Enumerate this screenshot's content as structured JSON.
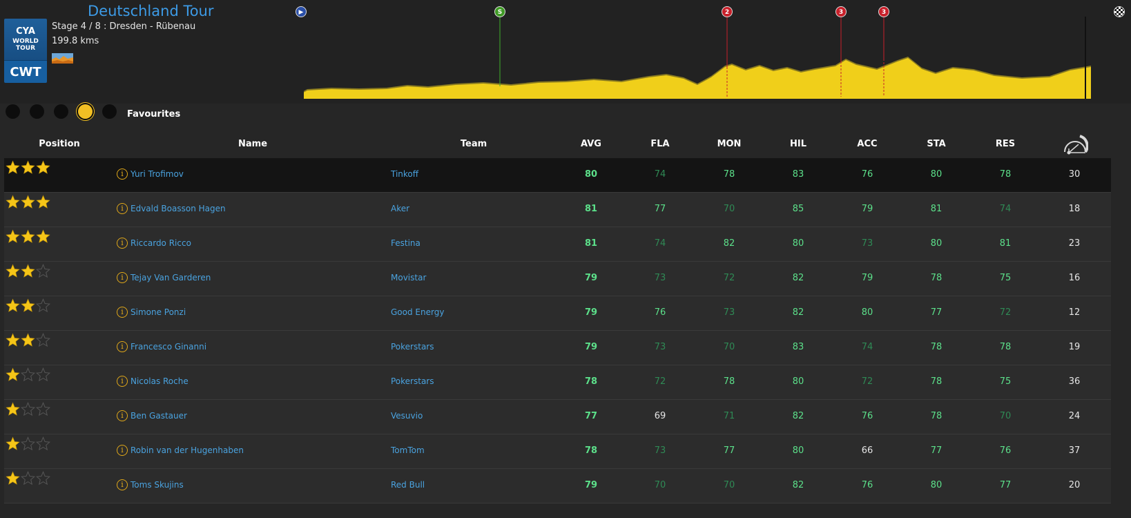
{
  "race": {
    "title": "Deutschland Tour",
    "stage": "Stage 4 / 8 : Dresden - Rübenau",
    "distance": "199.8 kms",
    "logo_top": "CYA",
    "logo_middle": "WORLD TOUR",
    "logo_bottom": "CWT",
    "terrain_icon": "hilly-terrain-icon"
  },
  "profile": {
    "fill_color": "#f0cf1a",
    "shadow_color": "#9a8a1e",
    "markers": [
      {
        "label": "",
        "kind": "start-icon"
      },
      {
        "label": "S",
        "kind": "sprint-icon"
      },
      {
        "label": "2",
        "kind": "climb-cat-2-icon"
      },
      {
        "label": "3",
        "kind": "climb-cat-3-icon"
      },
      {
        "label": "3",
        "kind": "climb-cat-3-icon"
      },
      {
        "label": "",
        "kind": "finish-flag-icon"
      }
    ]
  },
  "filter": {
    "label": "Favourites",
    "selected_index": 3,
    "accent": "#f2c024"
  },
  "columns": {
    "position": "Position",
    "name": "Name",
    "team": "Team",
    "avg": "AVG",
    "fla": "FLA",
    "mon": "MON",
    "hil": "HIL",
    "acc": "ACC",
    "sta": "STA",
    "res": "RES",
    "speed_icon": "speedometer-icon"
  },
  "colors": {
    "name_link": "#4aa3e0",
    "star": "#f5c518",
    "stat_bright": "#5ce08a",
    "stat_dim": "#2f8a55"
  },
  "riders": [
    {
      "stars": 3,
      "name": "Yuri Trofimov",
      "team": "Tinkoff",
      "avg": "80",
      "fla": "74",
      "mon": "78",
      "hil": "83",
      "acc": "76",
      "sta": "80",
      "res": "78",
      "last": "30",
      "styles": [
        "dim",
        "bright",
        "bright",
        "bright",
        "bright",
        "bright"
      ]
    },
    {
      "stars": 3,
      "name": "Edvald Boasson Hagen",
      "team": "Aker",
      "avg": "81",
      "fla": "77",
      "mon": "70",
      "hil": "85",
      "acc": "79",
      "sta": "81",
      "res": "74",
      "last": "18",
      "styles": [
        "bright",
        "dim",
        "bright",
        "bright",
        "bright",
        "dim"
      ]
    },
    {
      "stars": 3,
      "name": "Riccardo Ricco",
      "team": "Festina",
      "avg": "81",
      "fla": "74",
      "mon": "82",
      "hil": "80",
      "acc": "73",
      "sta": "80",
      "res": "81",
      "last": "23",
      "styles": [
        "dim",
        "bright",
        "bright",
        "dim",
        "bright",
        "bright"
      ]
    },
    {
      "stars": 2,
      "name": "Tejay Van Garderen",
      "team": "Movistar",
      "avg": "79",
      "fla": "73",
      "mon": "72",
      "hil": "82",
      "acc": "79",
      "sta": "78",
      "res": "75",
      "last": "16",
      "styles": [
        "dim",
        "dim",
        "bright",
        "bright",
        "bright",
        "bright"
      ]
    },
    {
      "stars": 2,
      "name": "Simone Ponzi",
      "team": "Good Energy",
      "avg": "79",
      "fla": "76",
      "mon": "73",
      "hil": "82",
      "acc": "80",
      "sta": "77",
      "res": "72",
      "last": "12",
      "styles": [
        "bright",
        "dim",
        "bright",
        "bright",
        "bright",
        "dim"
      ]
    },
    {
      "stars": 2,
      "name": "Francesco Ginanni",
      "team": "Pokerstars",
      "avg": "79",
      "fla": "73",
      "mon": "70",
      "hil": "83",
      "acc": "74",
      "sta": "78",
      "res": "78",
      "last": "19",
      "styles": [
        "dim",
        "dim",
        "bright",
        "dim",
        "bright",
        "bright"
      ]
    },
    {
      "stars": 1,
      "name": "Nicolas Roche",
      "team": "Pokerstars",
      "avg": "78",
      "fla": "72",
      "mon": "78",
      "hil": "80",
      "acc": "72",
      "sta": "78",
      "res": "75",
      "last": "36",
      "styles": [
        "dim",
        "bright",
        "bright",
        "dim",
        "bright",
        "bright"
      ]
    },
    {
      "stars": 1,
      "name": "Ben Gastauer",
      "team": "Vesuvio",
      "avg": "77",
      "fla": "69",
      "mon": "71",
      "hil": "82",
      "acc": "76",
      "sta": "78",
      "res": "70",
      "last": "24",
      "styles": [
        "white",
        "dim",
        "bright",
        "bright",
        "bright",
        "dim"
      ]
    },
    {
      "stars": 1,
      "name": "Robin van der Hugenhaben",
      "team": "TomTom",
      "avg": "78",
      "fla": "73",
      "mon": "77",
      "hil": "80",
      "acc": "66",
      "sta": "77",
      "res": "76",
      "last": "37",
      "styles": [
        "dim",
        "bright",
        "bright",
        "white",
        "bright",
        "bright"
      ]
    },
    {
      "stars": 1,
      "name": "Toms Skujins",
      "team": "Red Bull",
      "avg": "79",
      "fla": "70",
      "mon": "70",
      "hil": "82",
      "acc": "76",
      "sta": "80",
      "res": "77",
      "last": "20",
      "styles": [
        "dim",
        "dim",
        "bright",
        "bright",
        "bright",
        "bright"
      ]
    }
  ]
}
